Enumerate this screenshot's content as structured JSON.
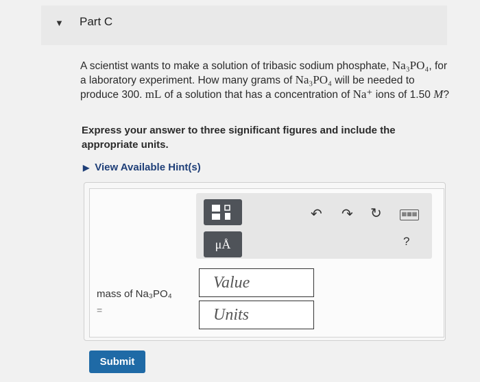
{
  "part": {
    "collapse_icon": "▼",
    "title": "Part C"
  },
  "question": {
    "t1": "A scientist wants to make a solution of tribasic sodium phosphate, ",
    "formula1": "Na₃PO₄",
    "t2": ", for a laboratory experiment. How many grams of ",
    "formula2": "Na₃PO₄",
    "t3": " will be needed to produce 300. ",
    "unit_ml": "mL",
    "t4": " of a solution that has a concentration of ",
    "ion": "Na⁺",
    "t5": " ions of 1.50 ",
    "unit_m": "M",
    "t6": "?"
  },
  "instruction": "Express your answer to three significant figures and include the appropriate units.",
  "hint": {
    "icon": "▶",
    "label": "View Available Hint(s)"
  },
  "toolbar": {
    "units_label": "μÅ",
    "undo_icon": "↶",
    "redo_icon": "↷",
    "reset_icon": "↻",
    "keyboard_icon": "▦▦▦",
    "help_label": "?"
  },
  "answer": {
    "label": "mass of Na₃PO₄",
    "equals": "=",
    "value_placeholder": "Value",
    "units_placeholder": "Units"
  },
  "submit_label": "Submit"
}
